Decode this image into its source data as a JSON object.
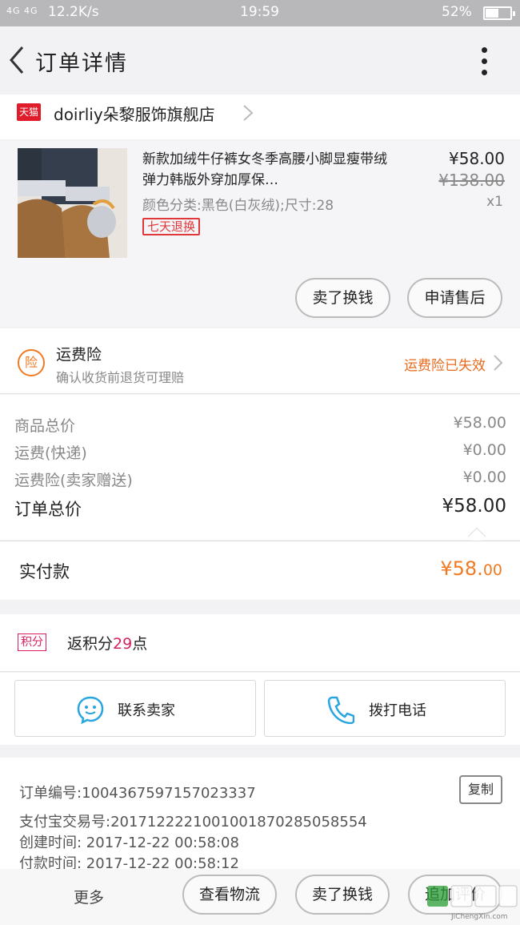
{
  "status_bar": {
    "signal": "4G 4G",
    "speed": "12.2K/s",
    "time": "19:59",
    "battery": "52%",
    "battery_level": 0.52
  },
  "header": {
    "title": "订单详情",
    "back_icon": "chevron-left-icon",
    "more_icon": "more-vertical-icon"
  },
  "shop": {
    "logo_text": "天猫",
    "name": "doirliy朵黎服饰旗舰店"
  },
  "product": {
    "title": "新款加绒牛仔裤女冬季高腰小脚显瘦带绒弹力韩版外穿加厚保…",
    "sku": "颜色分类:黑色(白灰绒);尺寸:28",
    "badge": "七天退换",
    "price": "¥58.00",
    "original_price": "¥138.00",
    "quantity": "x1",
    "actions": [
      "卖了换钱",
      "申请售后"
    ]
  },
  "insurance": {
    "icon_text": "险",
    "title": "运费险",
    "subtitle": "确认收货前退货可理赔",
    "status": "运费险已失效"
  },
  "price_breakdown": {
    "rows": [
      {
        "label": "商品总价",
        "value": "¥58.00"
      },
      {
        "label": "运费(快递)",
        "value": "¥0.00"
      },
      {
        "label": "运费险(卖家赠送)",
        "value": "¥0.00"
      }
    ],
    "total_label": "订单总价",
    "total_value": "¥58.00"
  },
  "payment": {
    "label": "实付款",
    "amount_main": "¥58.",
    "amount_decimal": "00"
  },
  "points": {
    "badge": "积分",
    "prefix": "返积分",
    "value": "29",
    "suffix": "点"
  },
  "contact": {
    "seller": "联系卖家",
    "phone": "拨打电话"
  },
  "order_info": {
    "order_no": "订单编号:1004367597157023337",
    "copy_label": "复制",
    "alipay_no": "支付宝交易号:2017122221001001870285058554",
    "created": "创建时间:  2017-12-22  00:58:08",
    "paid": "付款时间:  2017-12-22  00:58:12"
  },
  "bottom_bar": {
    "more": "更多",
    "buttons": [
      "查看物流",
      "卖了换钱",
      "追加评价"
    ]
  },
  "watermark": {
    "text": "JiChengXin.com"
  },
  "colors": {
    "accent_orange": "#f07a22",
    "tmall_red": "#e01c2a",
    "points_pink": "#d81e5b",
    "contact_blue": "#29a6e0"
  }
}
